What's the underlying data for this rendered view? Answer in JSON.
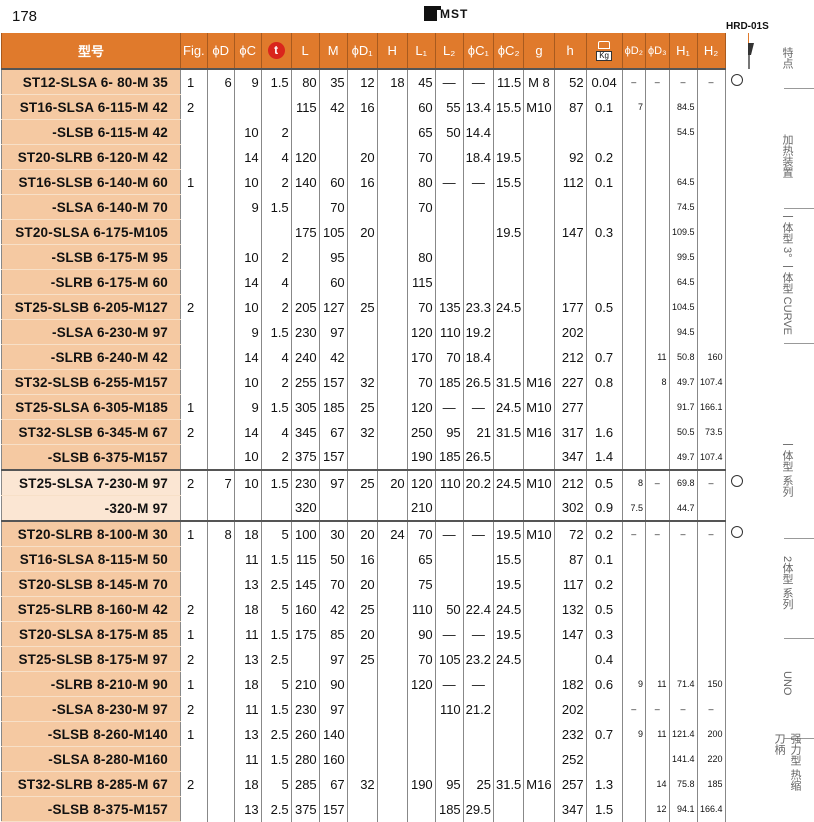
{
  "page_number": "178",
  "brand": "MST",
  "series_code": "HRD-01S",
  "headers": {
    "model": "型号",
    "fig": "Fig.",
    "phi_d": "ϕD",
    "phi_c": "ϕC",
    "t": "t",
    "L": "L",
    "M": "M",
    "phi_d1": "ϕD₁",
    "H": "H",
    "L1": "L₁",
    "L2": "L₂",
    "phi_c1": "ϕC₁",
    "phi_c2": "ϕC₂",
    "g": "g",
    "h": "h",
    "kg": "Kg",
    "phi_d2": "ϕD₂",
    "phi_d3": "ϕD₃",
    "H1": "H₁",
    "H2": "H₂"
  },
  "rows": [
    {
      "model": "ST12-SLSA 6-  80-M 35",
      "fig": "1",
      "D": "6",
      "C": "9",
      "t": "1.5",
      "L": "80",
      "M": "35",
      "D1": "12",
      "H": "18",
      "L1": "45",
      "L2": "—",
      "C1": "—",
      "C2": "11.5",
      "g": "M 8",
      "h": "52",
      "kg": "0.04",
      "D2": "–",
      "D3": "–",
      "H1": "–",
      "H2": "–",
      "mark": true,
      "group_start": true
    },
    {
      "model": "ST16-SLSA 6-115-M 42",
      "fig": "2",
      "D": "",
      "C": "",
      "t": "",
      "L": "115",
      "M": "42",
      "D1": "16",
      "H": "",
      "L1": "60",
      "L2": "55",
      "C1": "13.4",
      "C2": "15.5",
      "g": "M10",
      "h": "87",
      "kg": "0.1",
      "D2": "7",
      "D3": "",
      "H1": "84.5",
      "H2": ""
    },
    {
      "model": "-SLSB 6-115-M 42",
      "fig": "",
      "D": "",
      "C": "10",
      "t": "2",
      "L": "",
      "M": "",
      "D1": "",
      "H": "",
      "L1": "65",
      "L2": "50",
      "C1": "14.4",
      "C2": "",
      "g": "",
      "h": "",
      "kg": "",
      "D2": "",
      "D3": "",
      "H1": "54.5",
      "H2": ""
    },
    {
      "model": "ST20-SLRB 6-120-M 42",
      "fig": "",
      "D": "",
      "C": "14",
      "t": "4",
      "L": "120",
      "M": "",
      "D1": "20",
      "H": "",
      "L1": "70",
      "L2": "",
      "C1": "18.4",
      "C2": "19.5",
      "g": "",
      "h": "92",
      "kg": "0.2",
      "D2": "",
      "D3": "",
      "H1": "",
      "H2": ""
    },
    {
      "model": "ST16-SLSB 6-140-M 60",
      "fig": "1",
      "D": "",
      "C": "10",
      "t": "2",
      "L": "140",
      "M": "60",
      "D1": "16",
      "H": "",
      "L1": "80",
      "L2": "—",
      "C1": "—",
      "C2": "15.5",
      "g": "",
      "h": "112",
      "kg": "0.1",
      "D2": "",
      "D3": "",
      "H1": "64.5",
      "H2": ""
    },
    {
      "model": "-SLSA 6-140-M 70",
      "fig": "",
      "D": "",
      "C": "9",
      "t": "1.5",
      "L": "",
      "M": "70",
      "D1": "",
      "H": "",
      "L1": "70",
      "L2": "",
      "C1": "",
      "C2": "",
      "g": "",
      "h": "",
      "kg": "",
      "D2": "",
      "D3": "",
      "H1": "74.5",
      "H2": ""
    },
    {
      "model": "ST20-SLSA 6-175-M105",
      "fig": "",
      "D": "",
      "C": "",
      "t": "",
      "L": "175",
      "M": "105",
      "D1": "20",
      "H": "",
      "L1": "",
      "L2": "",
      "C1": "",
      "C2": "19.5",
      "g": "",
      "h": "147",
      "kg": "0.3",
      "D2": "",
      "D3": "",
      "H1": "109.5",
      "H2": ""
    },
    {
      "model": "-SLSB 6-175-M 95",
      "fig": "",
      "D": "",
      "C": "10",
      "t": "2",
      "L": "",
      "M": "95",
      "D1": "",
      "H": "",
      "L1": "80",
      "L2": "",
      "C1": "",
      "C2": "",
      "g": "",
      "h": "",
      "kg": "",
      "D2": "",
      "D3": "",
      "H1": "99.5",
      "H2": ""
    },
    {
      "model": "-SLRB 6-175-M 60",
      "fig": "",
      "D": "",
      "C": "14",
      "t": "4",
      "L": "",
      "M": "60",
      "D1": "",
      "H": "",
      "L1": "115",
      "L2": "",
      "C1": "",
      "C2": "",
      "g": "",
      "h": "",
      "kg": "",
      "D2": "",
      "D3": "",
      "H1": "64.5",
      "H2": ""
    },
    {
      "model": "ST25-SLSB 6-205-M127",
      "fig": "2",
      "D": "",
      "C": "10",
      "t": "2",
      "L": "205",
      "M": "127",
      "D1": "25",
      "H": "",
      "L1": "70",
      "L2": "135",
      "C1": "23.3",
      "C2": "24.5",
      "g": "",
      "h": "177",
      "kg": "0.5",
      "D2": "",
      "D3": "",
      "H1": "104.5",
      "H2": ""
    },
    {
      "model": "-SLSA 6-230-M 97",
      "fig": "",
      "D": "",
      "C": "9",
      "t": "1.5",
      "L": "230",
      "M": "97",
      "D1": "",
      "H": "",
      "L1": "120",
      "L2": "110",
      "C1": "19.2",
      "C2": "",
      "g": "",
      "h": "202",
      "kg": "",
      "D2": "",
      "D3": "",
      "H1": "94.5",
      "H2": ""
    },
    {
      "model": "-SLRB 6-240-M 42",
      "fig": "",
      "D": "",
      "C": "14",
      "t": "4",
      "L": "240",
      "M": "42",
      "D1": "",
      "H": "",
      "L1": "170",
      "L2": "70",
      "C1": "18.4",
      "C2": "",
      "g": "",
      "h": "212",
      "kg": "0.7",
      "D2": "",
      "D3": "11",
      "H1": "50.8",
      "H2": "160"
    },
    {
      "model": "ST32-SLSB 6-255-M157",
      "fig": "",
      "D": "",
      "C": "10",
      "t": "2",
      "L": "255",
      "M": "157",
      "D1": "32",
      "H": "",
      "L1": "70",
      "L2": "185",
      "C1": "26.5",
      "C2": "31.5",
      "g": "M16",
      "h": "227",
      "kg": "0.8",
      "D2": "",
      "D3": "8",
      "H1": "49.7",
      "H2": "107.4"
    },
    {
      "model": "ST25-SLSA 6-305-M185",
      "fig": "1",
      "D": "",
      "C": "9",
      "t": "1.5",
      "L": "305",
      "M": "185",
      "D1": "25",
      "H": "",
      "L1": "120",
      "L2": "—",
      "C1": "—",
      "C2": "24.5",
      "g": "M10",
      "h": "277",
      "kg": "",
      "D2": "",
      "D3": "",
      "H1": "91.7",
      "H2": "166.1"
    },
    {
      "model": "ST32-SLSB 6-345-M 67",
      "fig": "2",
      "D": "",
      "C": "14",
      "t": "4",
      "L": "345",
      "M": "67",
      "D1": "32",
      "H": "",
      "L1": "250",
      "L2": "95",
      "C1": "21",
      "C2": "31.5",
      "g": "M16",
      "h": "317",
      "kg": "1.6",
      "D2": "",
      "D3": "",
      "H1": "50.5",
      "H2": "73.5"
    },
    {
      "model": "-SLSB 6-375-M157",
      "fig": "",
      "D": "",
      "C": "10",
      "t": "2",
      "L": "375",
      "M": "157",
      "D1": "",
      "H": "",
      "L1": "190",
      "L2": "185",
      "C1": "26.5",
      "C2": "",
      "g": "",
      "h": "347",
      "kg": "1.4",
      "D2": "",
      "D3": "",
      "H1": "49.7",
      "H2": "107.4",
      "last": true
    },
    {
      "model": "ST25-SLSA 7-230-M 97",
      "fig": "2",
      "D": "7",
      "C": "10",
      "t": "1.5",
      "L": "230",
      "M": "97",
      "D1": "25",
      "H": "20",
      "L1": "120",
      "L2": "110",
      "C1": "20.2",
      "C2": "24.5",
      "g": "M10",
      "h": "212",
      "kg": "0.5",
      "D2": "8",
      "D3": "–",
      "H1": "69.8",
      "H2": "–",
      "mark": true,
      "group_start": true,
      "light": true
    },
    {
      "model": "-320-M 97",
      "fig": "",
      "D": "",
      "C": "",
      "t": "",
      "L": "320",
      "M": "",
      "D1": "",
      "H": "",
      "L1": "210",
      "L2": "",
      "C1": "",
      "C2": "",
      "g": "",
      "h": "302",
      "kg": "0.9",
      "D2": "7.5",
      "D3": "",
      "H1": "44.7",
      "H2": "",
      "light": true,
      "last": true
    },
    {
      "model": "ST20-SLRB 8-100-M 30",
      "fig": "1",
      "D": "8",
      "C": "18",
      "t": "5",
      "L": "100",
      "M": "30",
      "D1": "20",
      "H": "24",
      "L1": "70",
      "L2": "—",
      "C1": "—",
      "C2": "19.5",
      "g": "M10",
      "h": "72",
      "kg": "0.2",
      "D2": "–",
      "D3": "–",
      "H1": "–",
      "H2": "–",
      "mark": true,
      "group_start": true
    },
    {
      "model": "ST16-SLSA 8-115-M 50",
      "fig": "",
      "D": "",
      "C": "11",
      "t": "1.5",
      "L": "115",
      "M": "50",
      "D1": "16",
      "H": "",
      "L1": "65",
      "L2": "",
      "C1": "",
      "C2": "15.5",
      "g": "",
      "h": "87",
      "kg": "0.1",
      "D2": "",
      "D3": "",
      "H1": "",
      "H2": ""
    },
    {
      "model": "ST20-SLSB 8-145-M 70",
      "fig": "",
      "D": "",
      "C": "13",
      "t": "2.5",
      "L": "145",
      "M": "70",
      "D1": "20",
      "H": "",
      "L1": "75",
      "L2": "",
      "C1": "",
      "C2": "19.5",
      "g": "",
      "h": "117",
      "kg": "0.2",
      "D2": "",
      "D3": "",
      "H1": "",
      "H2": ""
    },
    {
      "model": "ST25-SLRB 8-160-M 42",
      "fig": "2",
      "D": "",
      "C": "18",
      "t": "5",
      "L": "160",
      "M": "42",
      "D1": "25",
      "H": "",
      "L1": "110",
      "L2": "50",
      "C1": "22.4",
      "C2": "24.5",
      "g": "",
      "h": "132",
      "kg": "0.5",
      "D2": "",
      "D3": "",
      "H1": "",
      "H2": ""
    },
    {
      "model": "ST20-SLSA 8-175-M 85",
      "fig": "1",
      "D": "",
      "C": "11",
      "t": "1.5",
      "L": "175",
      "M": "85",
      "D1": "20",
      "H": "",
      "L1": "90",
      "L2": "—",
      "C1": "—",
      "C2": "19.5",
      "g": "",
      "h": "147",
      "kg": "0.3",
      "D2": "",
      "D3": "",
      "H1": "",
      "H2": ""
    },
    {
      "model": "ST25-SLSB 8-175-M 97",
      "fig": "2",
      "D": "",
      "C": "13",
      "t": "2.5",
      "L": "",
      "M": "97",
      "D1": "25",
      "H": "",
      "L1": "70",
      "L2": "105",
      "C1": "23.2",
      "C2": "24.5",
      "g": "",
      "h": "",
      "kg": "0.4",
      "D2": "",
      "D3": "",
      "H1": "",
      "H2": ""
    },
    {
      "model": "-SLRB 8-210-M 90",
      "fig": "1",
      "D": "",
      "C": "18",
      "t": "5",
      "L": "210",
      "M": "90",
      "D1": "",
      "H": "",
      "L1": "120",
      "L2": "—",
      "C1": "—",
      "C2": "",
      "g": "",
      "h": "182",
      "kg": "0.6",
      "D2": "9",
      "D3": "11",
      "H1": "71.4",
      "H2": "150"
    },
    {
      "model": "-SLSA 8-230-M 97",
      "fig": "2",
      "D": "",
      "C": "11",
      "t": "1.5",
      "L": "230",
      "M": "97",
      "D1": "",
      "H": "",
      "L1": "",
      "L2": "110",
      "C1": "21.2",
      "C2": "",
      "g": "",
      "h": "202",
      "kg": "",
      "D2": "–",
      "D3": "–",
      "H1": "–",
      "H2": "–"
    },
    {
      "model": "-SLSB 8-260-M140",
      "fig": "1",
      "D": "",
      "C": "13",
      "t": "2.5",
      "L": "260",
      "M": "140",
      "D1": "",
      "H": "",
      "L1": "",
      "L2": "",
      "C1": "",
      "C2": "",
      "g": "",
      "h": "232",
      "kg": "0.7",
      "D2": "9",
      "D3": "11",
      "H1": "121.4",
      "H2": "200"
    },
    {
      "model": "-SLSA 8-280-M160",
      "fig": "",
      "D": "",
      "C": "11",
      "t": "1.5",
      "L": "280",
      "M": "160",
      "D1": "",
      "H": "",
      "L1": "",
      "L2": "",
      "C1": "",
      "C2": "",
      "g": "",
      "h": "252",
      "kg": "",
      "D2": "",
      "D3": "",
      "H1": "141.4",
      "H2": "220"
    },
    {
      "model": "ST32-SLRB 8-285-M 67",
      "fig": "2",
      "D": "",
      "C": "18",
      "t": "5",
      "L": "285",
      "M": "67",
      "D1": "32",
      "H": "",
      "L1": "190",
      "L2": "95",
      "C1": "25",
      "C2": "31.5",
      "g": "M16",
      "h": "257",
      "kg": "1.3",
      "D2": "",
      "D3": "14",
      "H1": "75.8",
      "H2": "185"
    },
    {
      "model": "-SLSB 8-375-M157",
      "fig": "",
      "D": "",
      "C": "13",
      "t": "2.5",
      "L": "375",
      "M": "157",
      "D1": "",
      "H": "",
      "L1": "",
      "L2": "185",
      "C1": "29.5",
      "C2": "",
      "g": "",
      "h": "347",
      "kg": "1.5",
      "D2": "",
      "D3": "12",
      "H1": "94.1",
      "H2": "166.4"
    }
  ],
  "side_nav": [
    {
      "label": "特点"
    },
    {
      "label": "加热装置"
    },
    {
      "label": "一体型 3° 一体型 CURVE"
    },
    {
      "label": "一体型 系列"
    },
    {
      "label": "2体型 系列"
    },
    {
      "label": "UNO"
    },
    {
      "label": "强力型 热缩刀柄"
    }
  ],
  "colors": {
    "header": "#e07a2c",
    "model_cell": "#f5c9a2",
    "model_cell_light": "#fbe6d3",
    "t_badge": "#d9251c"
  }
}
